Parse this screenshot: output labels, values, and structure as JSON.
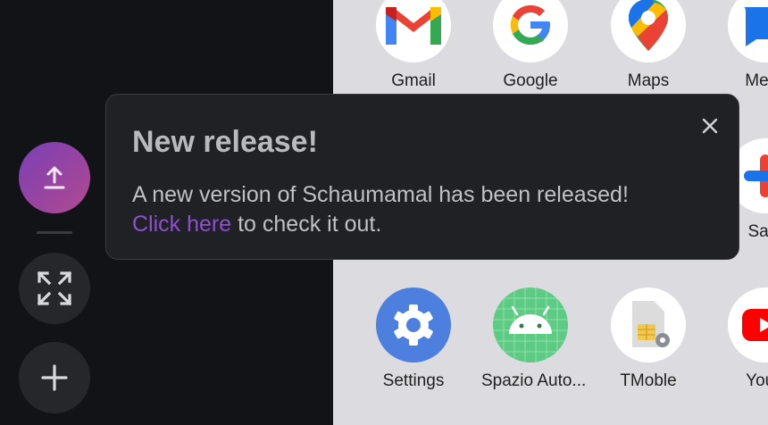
{
  "apps": [
    {
      "label": "Gmail",
      "icon": "gmail-icon"
    },
    {
      "label": "Google",
      "icon": "google-icon"
    },
    {
      "label": "Maps",
      "icon": "maps-icon"
    },
    {
      "label": "Mess",
      "icon": "messages-icon"
    },
    {
      "label": "Safe",
      "icon": "safety-icon"
    },
    {
      "label": "Settings",
      "icon": "settings-icon"
    },
    {
      "label": "Spazio Auto...",
      "icon": "android-auto-icon"
    },
    {
      "label": "TMoble",
      "icon": "sim-card-icon"
    },
    {
      "label": "YouT",
      "icon": "youtube-icon"
    }
  ],
  "popup": {
    "title": "New release!",
    "message": "A new version of Schaumamal has been released!",
    "link_text": "Click here",
    "link_suffix": " to check it out."
  },
  "sidebar": {
    "buttons": [
      "upload-icon",
      "expand-icon",
      "plus-icon"
    ]
  },
  "colors": {
    "accent_purple": "#8f4fd0",
    "popup_bg": "#202124",
    "sidebar_bg": "#121316",
    "drawer_bg": "#dcdbe0"
  }
}
